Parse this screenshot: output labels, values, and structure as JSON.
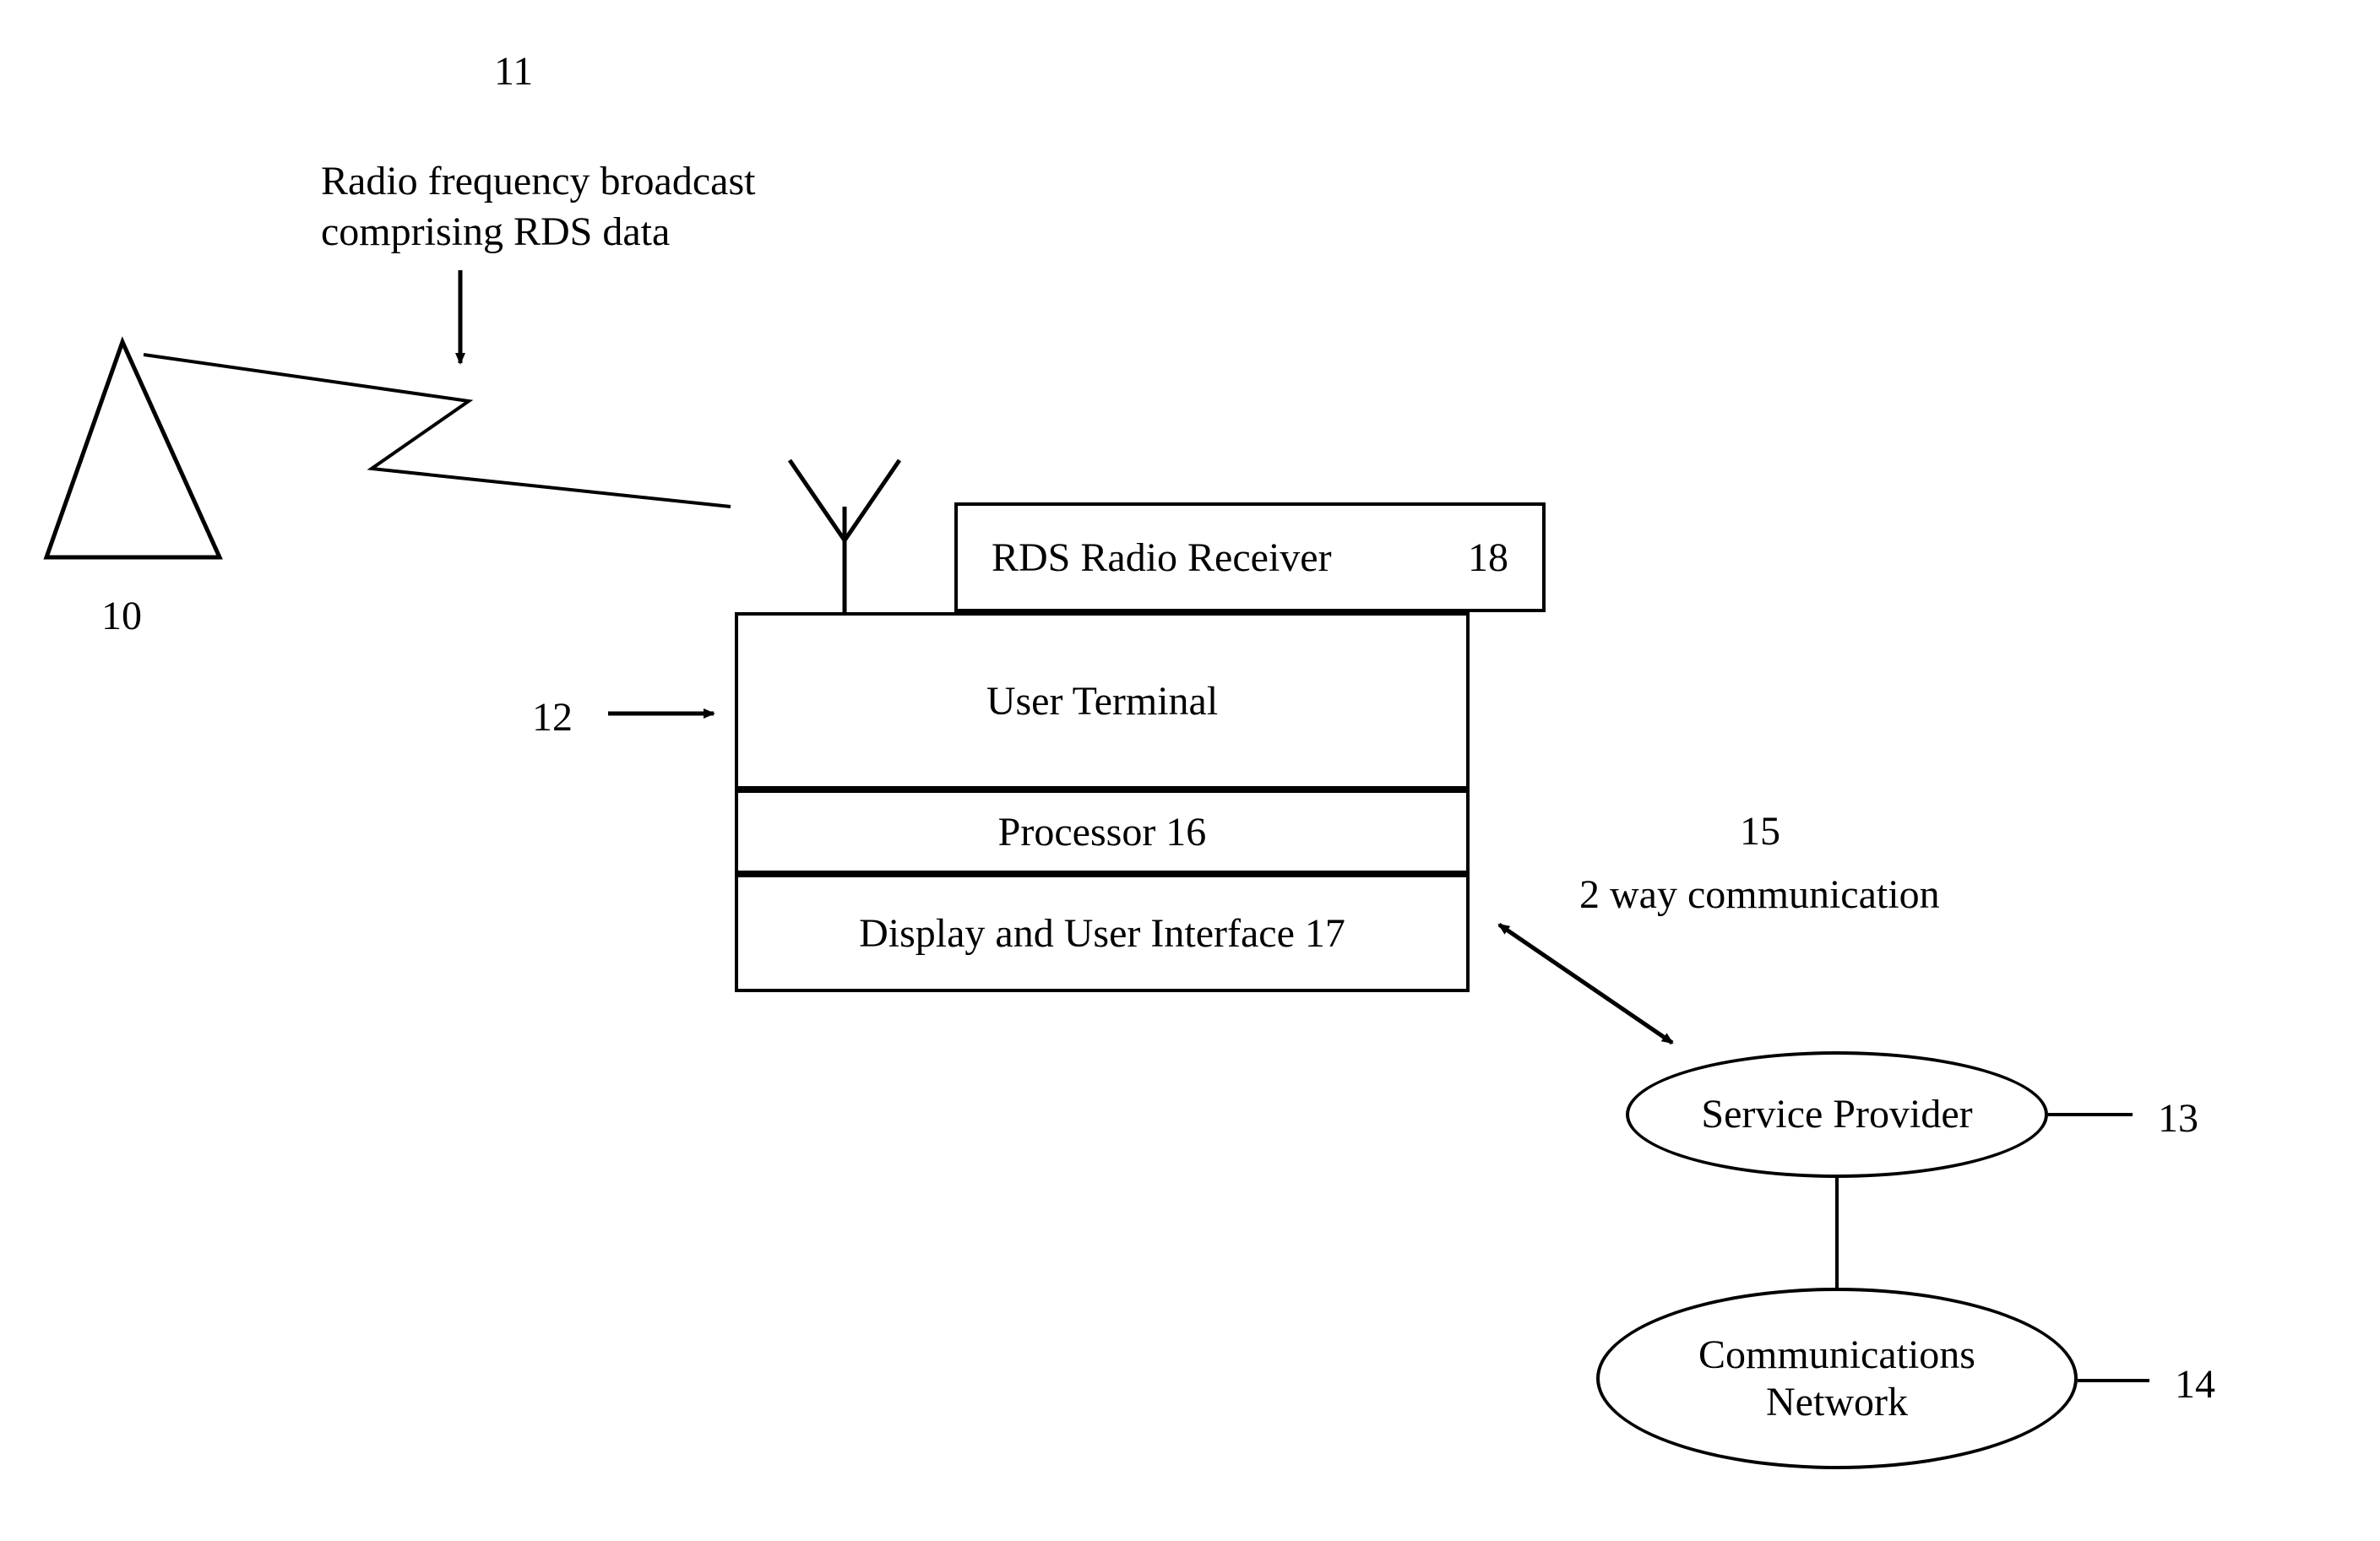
{
  "refs": {
    "tower": "10",
    "broadcast": "11",
    "terminal": "12",
    "service_provider": "13",
    "comm_network": "14",
    "two_way": "15",
    "processor_suffix": "16",
    "display_suffix": "17",
    "receiver_suffix": "18"
  },
  "labels": {
    "broadcast_line1": "Radio frequency broadcast",
    "broadcast_line2": "comprising RDS data",
    "rds_receiver": "RDS Radio Receiver",
    "user_terminal": "User Terminal",
    "processor": "Processor 16",
    "display_ui": "Display and User Interface 17",
    "two_way": "2 way communication",
    "service_provider": "Service Provider",
    "communications": "Communications",
    "network": "Network"
  }
}
